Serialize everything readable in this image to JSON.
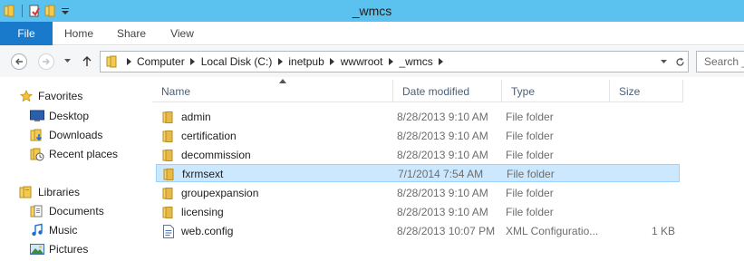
{
  "window": {
    "title": "_wmcs",
    "titlebar_color": "#5bc1ee",
    "quick_access": [
      "folder-icon",
      "properties-icon",
      "new-folder-icon",
      "customize-dropdown-icon"
    ]
  },
  "ribbon": {
    "tabs": [
      {
        "label": "File",
        "active": true,
        "color": "#1979ca"
      },
      {
        "label": "Home"
      },
      {
        "label": "Share"
      },
      {
        "label": "View"
      }
    ]
  },
  "address": {
    "crumbs": [
      "Computer",
      "Local Disk (C:)",
      "inetpub",
      "wwwroot",
      "_wmcs"
    ],
    "search_placeholder": "Search _wmcs"
  },
  "nav": {
    "groups": [
      {
        "label": "Favorites",
        "icon": "star-icon",
        "items": [
          {
            "label": "Desktop",
            "icon": "desktop-icon"
          },
          {
            "label": "Downloads",
            "icon": "downloads-icon"
          },
          {
            "label": "Recent places",
            "icon": "recent-places-icon"
          }
        ]
      },
      {
        "label": "Libraries",
        "icon": "libraries-icon",
        "items": [
          {
            "label": "Documents",
            "icon": "documents-icon"
          },
          {
            "label": "Music",
            "icon": "music-icon"
          },
          {
            "label": "Pictures",
            "icon": "pictures-icon"
          }
        ]
      }
    ]
  },
  "list": {
    "columns": [
      "Name",
      "Date modified",
      "Type",
      "Size"
    ],
    "sorted_by": "Name",
    "rows": [
      {
        "name": "admin",
        "date": "8/28/2013 9:10 AM",
        "type": "File folder",
        "size": "",
        "icon": "folder-icon"
      },
      {
        "name": "certification",
        "date": "8/28/2013 9:10 AM",
        "type": "File folder",
        "size": "",
        "icon": "folder-icon"
      },
      {
        "name": "decommission",
        "date": "8/28/2013 9:10 AM",
        "type": "File folder",
        "size": "",
        "icon": "folder-icon"
      },
      {
        "name": "fxrmsext",
        "date": "7/1/2014 7:54 AM",
        "type": "File folder",
        "size": "",
        "icon": "folder-icon",
        "selected": true
      },
      {
        "name": "groupexpansion",
        "date": "8/28/2013 9:10 AM",
        "type": "File folder",
        "size": "",
        "icon": "folder-icon"
      },
      {
        "name": "licensing",
        "date": "8/28/2013 9:10 AM",
        "type": "File folder",
        "size": "",
        "icon": "folder-icon"
      },
      {
        "name": "web.config",
        "date": "8/28/2013 10:07 PM",
        "type": "XML Configuratio...",
        "size": "1 KB",
        "icon": "config-file-icon"
      }
    ]
  },
  "colors": {
    "selection_bg": "#cce8ff",
    "selection_border": "#99d1ff",
    "folder": "#e8b84a"
  }
}
